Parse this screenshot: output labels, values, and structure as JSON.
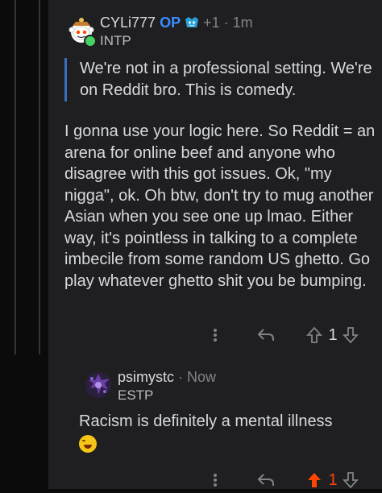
{
  "comment1": {
    "username": "CYLi777",
    "op_badge": "OP",
    "award_count": "+1",
    "separator": "·",
    "time": "1m",
    "flair": "INTP",
    "quote": "We're not in a professional setting. We're on Reddit bro. This is comedy.",
    "body": "I gonna use your logic here. So Reddit = an arena for online beef and anyone who disagree with this got issues. Ok, \"my nigga\", ok. Oh btw, don't try to mug another Asian when you see one up lmao. Either way, it's pointless in talking to a complete imbecile from some random US ghetto. Go play whatever ghetto shit you be bumping.",
    "more_icon": "more-vertical-icon",
    "reply_icon": "reply-icon",
    "vote_count": "1",
    "upvote_icon": "upvote-icon",
    "downvote_icon": "downvote-icon"
  },
  "comment2": {
    "username": "psimystc",
    "separator": "·",
    "time": "Now",
    "flair": "ESTP",
    "body": "Racism is definitely a mental illness",
    "emoji": "laughing-tears-emoji",
    "vote_count": "1",
    "upvote_color": "#ff4500"
  }
}
